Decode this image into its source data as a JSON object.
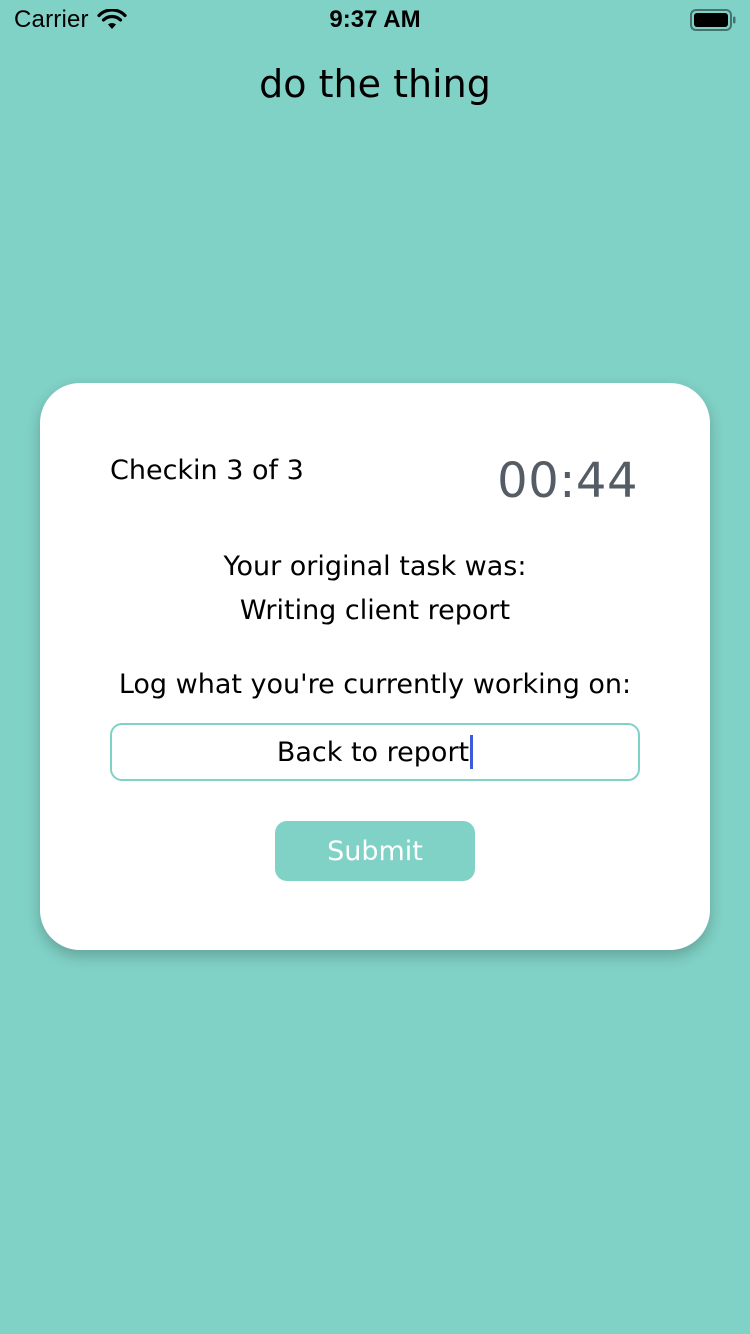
{
  "status_bar": {
    "carrier": "Carrier",
    "time": "9:37 AM",
    "wifi_icon": "wifi-icon",
    "battery_icon": "battery-full-icon"
  },
  "app": {
    "title": "do the thing",
    "background_color": "#80d1c6"
  },
  "card": {
    "checkin_label": "Checkin 3 of 3",
    "timer": "00:44",
    "original_task_label": "Your original task was:",
    "original_task": "Writing client report",
    "log_prompt": "Log what you're currently working on:",
    "log_input_value": "Back to report",
    "submit_label": "Submit",
    "accent_color": "#80d1c6",
    "caret_color": "#3d5bd9"
  }
}
